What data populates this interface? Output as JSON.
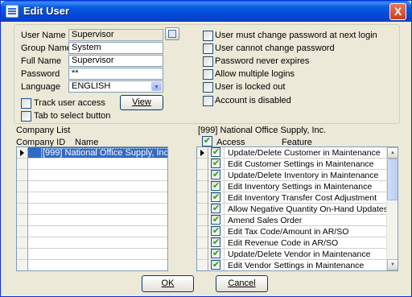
{
  "window": {
    "title": "Edit User",
    "close_label": "X"
  },
  "form": {
    "user_name_label": "User Name",
    "user_name_value": "Supervisor",
    "group_name_label": "Group Name",
    "group_name_value": "System",
    "full_name_label": "Full Name",
    "full_name_value": "Supervisor",
    "password_label": "Password",
    "password_value": "**",
    "language_label": "Language",
    "language_value": "ENGLISH",
    "view_button": "View",
    "track_user_access": {
      "label": "Track user access",
      "checked": false
    },
    "tab_to_select": {
      "label": "Tab to select button",
      "checked": false
    }
  },
  "options": [
    {
      "label": "User must change password at next login",
      "checked": false
    },
    {
      "label": "User cannot change password",
      "checked": false
    },
    {
      "label": "Password never expires",
      "checked": false
    },
    {
      "label": "Allow multiple logins",
      "checked": false
    },
    {
      "label": "User is locked out",
      "checked": false
    },
    {
      "label": "Account is disabled",
      "checked": false
    }
  ],
  "company_list": {
    "title": "Company List",
    "col_id": "Company ID",
    "col_name": "Name",
    "rows": [
      "[999] National Office Supply, Inc."
    ]
  },
  "access": {
    "title": "[999] National Office Supply, Inc.",
    "col_access": "Access",
    "col_feature": "Feature",
    "header_checked": true,
    "rows": [
      {
        "feature": "Update/Delete Customer in Maintenance",
        "checked": true
      },
      {
        "feature": "Edit Customer Settings in Maintenance",
        "checked": true
      },
      {
        "feature": "Update/Delete Inventory in Maintenance",
        "checked": true
      },
      {
        "feature": "Edit Inventory Settings in Maintenance",
        "checked": true
      },
      {
        "feature": "Edit Inventory Transfer Cost Adjustment",
        "checked": true
      },
      {
        "feature": "Allow Negative Quantity On-Hand Updates",
        "checked": true
      },
      {
        "feature": "Amend Sales Order",
        "checked": true
      },
      {
        "feature": "Edit Tax Code/Amount in AR/SO",
        "checked": true
      },
      {
        "feature": "Edit Revenue Code in AR/SO",
        "checked": true
      },
      {
        "feature": "Update/Delete Vendor in Maintenance",
        "checked": true
      },
      {
        "feature": "Edit Vendor Settings in Maintenance",
        "checked": true
      }
    ]
  },
  "buttons": {
    "ok": "OK",
    "cancel": "Cancel"
  }
}
